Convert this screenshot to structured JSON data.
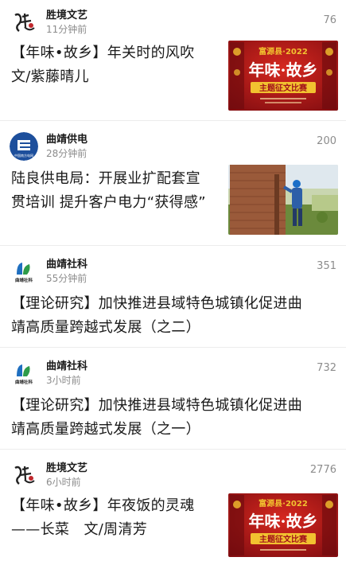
{
  "feed": [
    {
      "source": "胜境文艺",
      "time": "11分钟前",
      "views": "76",
      "title_line1": "【年味•故乡】年关时的风吹",
      "title_line2": "文/紫藤晴儿",
      "avatar_icon": "shengjing-logo-icon",
      "thumb_texts": {
        "top": "富源县·2022",
        "main": "年味·故乡",
        "sub": "主题征文比赛"
      }
    },
    {
      "source": "曲靖供电",
      "time": "28分钟前",
      "views": "200",
      "title_line1": "陆良供电局：开展业扩配套宣",
      "title_line2": "贯培训 提升客户电力“获得感”",
      "avatar_icon": "china-southern-grid-logo-icon",
      "avatar_text": "中国南方电网"
    },
    {
      "source": "曲靖社科",
      "time": "55分钟前",
      "views": "351",
      "title_line1": "【理论研究】加快推进县域特色城镇化促进曲",
      "title_line2": "靖高质量跨越式发展（之二）",
      "avatar_icon": "qujing-sheke-logo-icon",
      "avatar_text": "曲靖社科"
    },
    {
      "source": "曲靖社科",
      "time": "3小时前",
      "views": "732",
      "title_line1": "【理论研究】加快推进县域特色城镇化促进曲",
      "title_line2": "靖高质量跨越式发展（之一）",
      "avatar_icon": "qujing-sheke-logo-icon",
      "avatar_text": "曲靖社科"
    },
    {
      "source": "胜境文艺",
      "time": "6小时前",
      "views": "2776",
      "title_line1": "【年味•故乡】年夜饭的灵魂",
      "title_line2": "——长菜　文/周清芳",
      "avatar_icon": "shengjing-logo-icon",
      "thumb_texts": {
        "top": "富源县·2022",
        "main": "年味·故乡",
        "sub": "主题征文比赛"
      }
    }
  ],
  "colors": {
    "poster_red": "#b3121a",
    "poster_gold": "#f2c230",
    "grid_blue": "#1d4f9c",
    "sheke_green": "#2e9b4a",
    "sheke_blue": "#1f6fc0",
    "brick": "#9a5a3a"
  }
}
